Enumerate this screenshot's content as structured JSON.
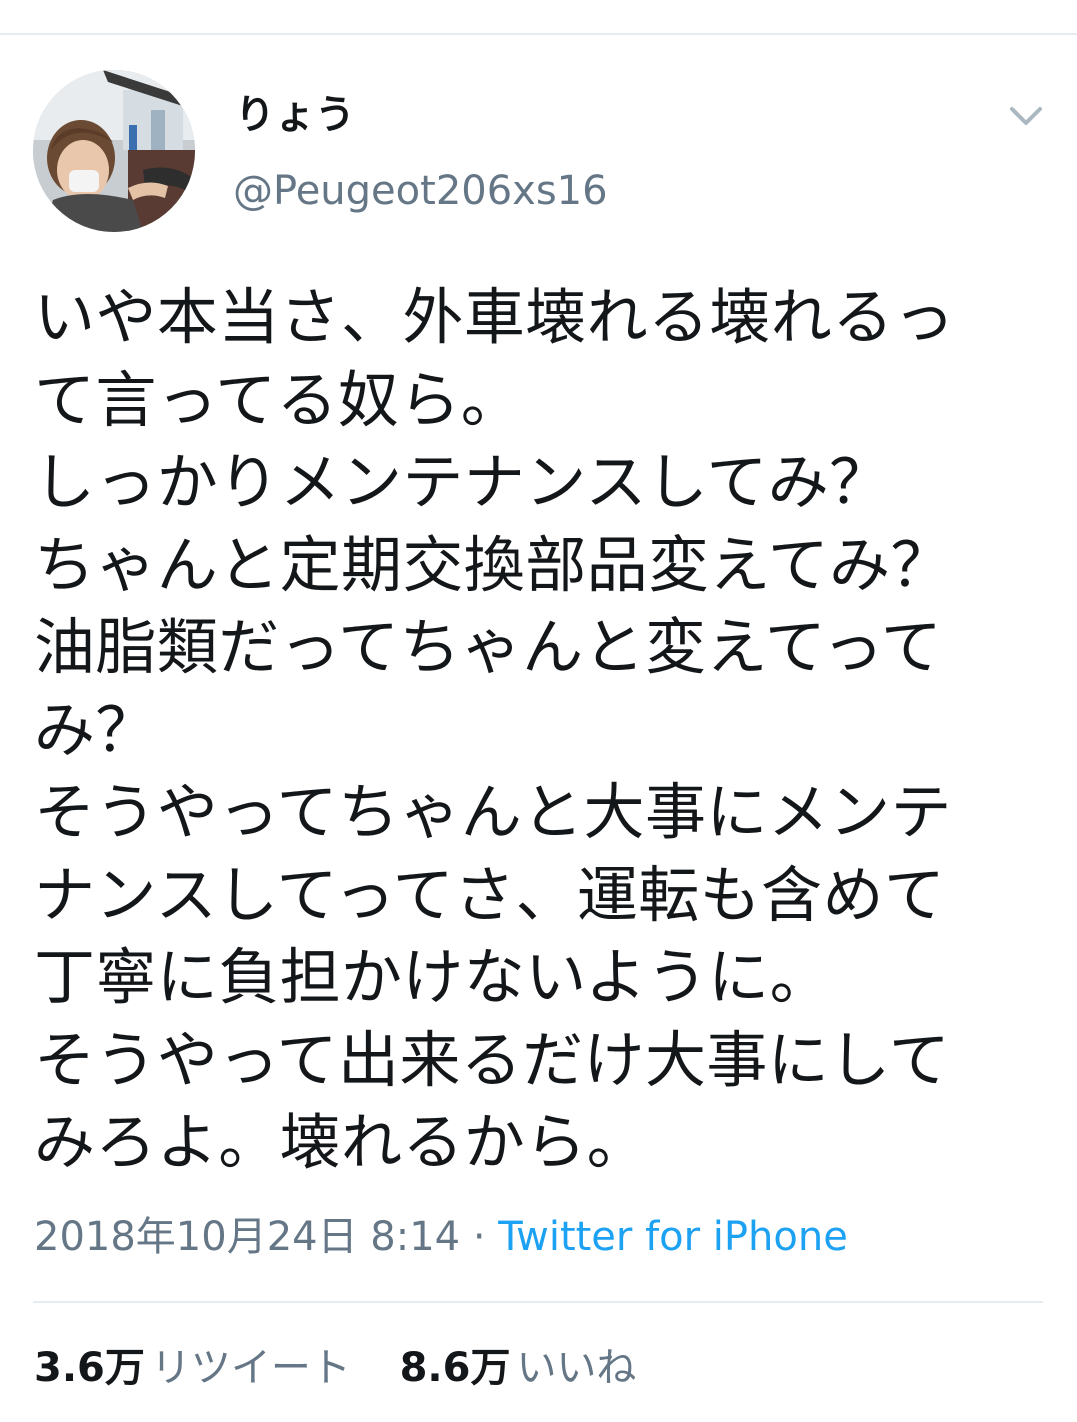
{
  "user": {
    "display_name": "りょう",
    "handle": "@Peugeot206xs16"
  },
  "tweet": {
    "lines": [
      "いや本当さ、外車壊れる壊れるっ",
      "て言ってる奴ら。",
      "しっかりメンテナンスしてみ？",
      "ちゃんと定期交換部品変えてみ？",
      "油脂類だってちゃんと変えてって",
      "み？",
      "そうやってちゃんと大事にメンテ",
      "ナンスしてってさ、運転も含めて",
      "丁寧に負担かけないように。",
      "そうやって出来るだけ大事にして",
      "みろよ。壊れるから。"
    ]
  },
  "meta": {
    "timestamp": "2018年10月24日 8:14",
    "separator": " · ",
    "source": "Twitter for iPhone"
  },
  "stats": {
    "retweets_count": "3.6万",
    "retweets_label": "リツイート",
    "likes_count": "8.6万",
    "likes_label": "いいね"
  },
  "icons": {
    "menu": "chevron-down-icon",
    "avatar": "avatar"
  },
  "colors": {
    "text": "#14171a",
    "secondary": "#657786",
    "link": "#1da1f2",
    "divider": "#e6ecf0"
  }
}
